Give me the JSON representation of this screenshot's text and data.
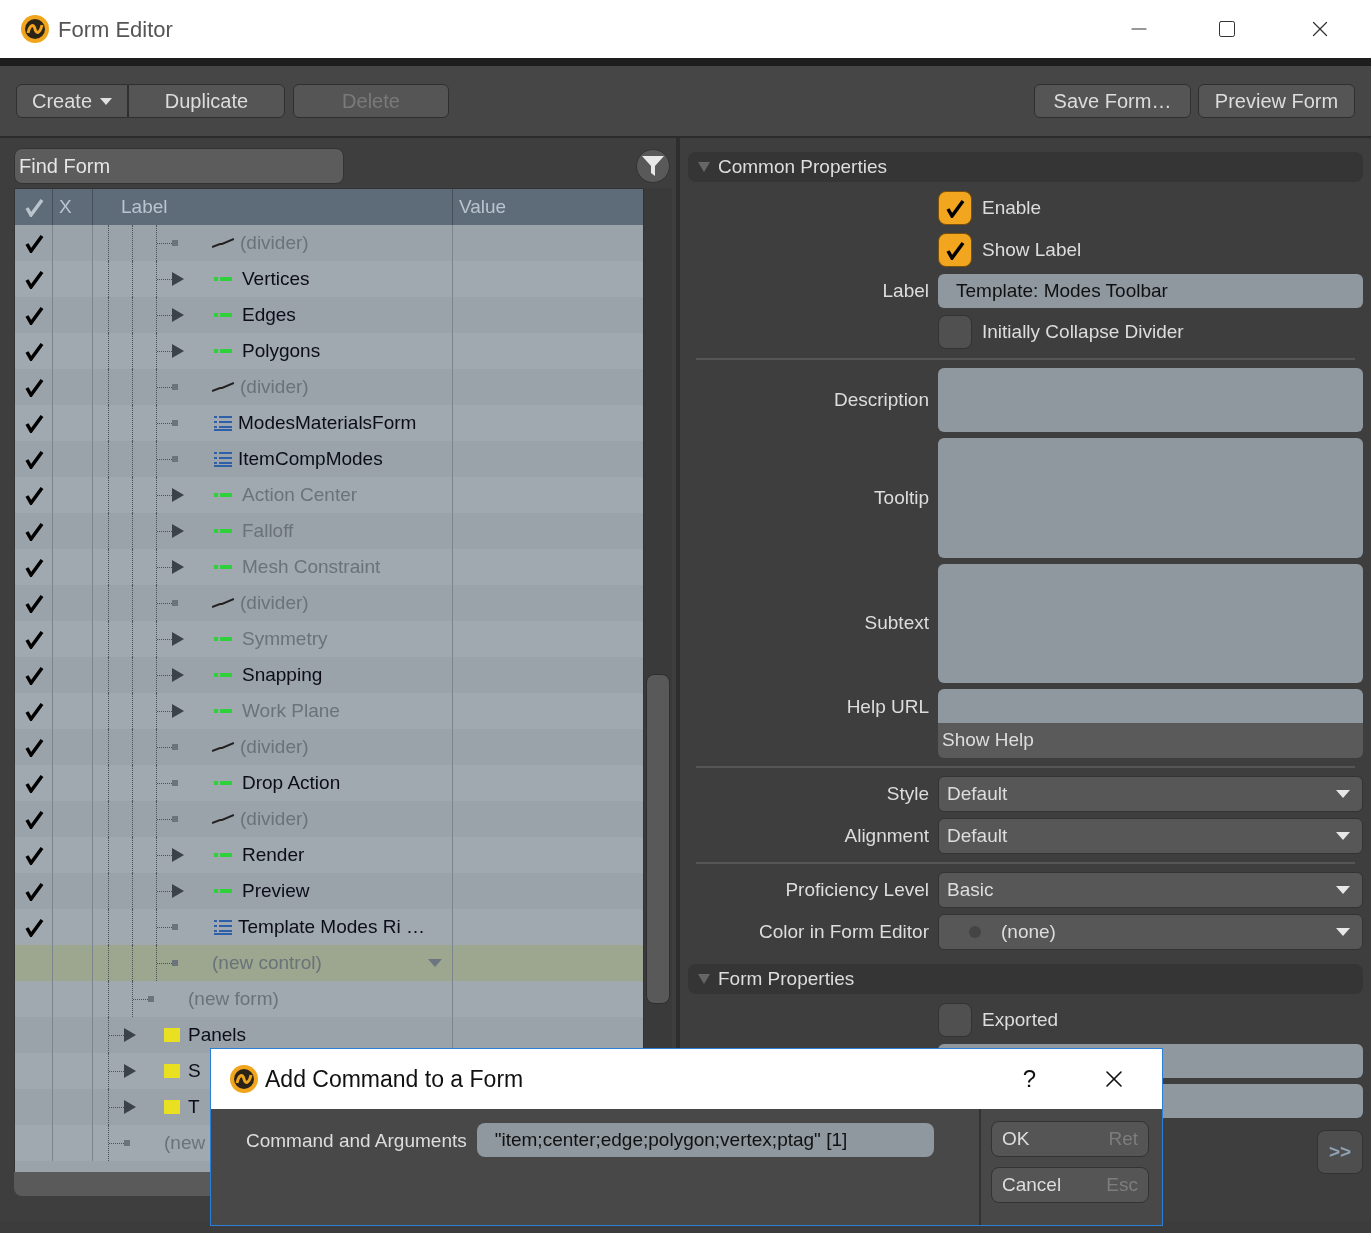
{
  "window": {
    "title": "Form Editor"
  },
  "toolbar": {
    "left": [
      {
        "label": "Create",
        "kind": "menu",
        "disabled": false
      },
      {
        "label": "Duplicate",
        "disabled": false
      },
      {
        "label": "Delete",
        "disabled": true
      }
    ],
    "right": [
      {
        "label": "Save Form…",
        "disabled": false
      },
      {
        "label": "Preview Form",
        "disabled": false
      }
    ]
  },
  "search": {
    "placeholder": "Find Form"
  },
  "tree": {
    "columns": [
      "X",
      "Label",
      "Value"
    ],
    "rows": [
      {
        "children": [
          {
            "children": [
              {
                "label": "(divider)",
                "kind": "divider",
                "expandable": false,
                "enabled": true,
                "dimmed": true,
                "selected": false
              },
              {
                "label": "Vertices",
                "kind": "command",
                "expandable": true,
                "enabled": true,
                "dimmed": false,
                "selected": false
              },
              {
                "label": "Edges",
                "kind": "command",
                "expandable": true,
                "enabled": true,
                "dimmed": false,
                "selected": false
              },
              {
                "label": "Polygons",
                "kind": "command",
                "expandable": true,
                "enabled": true,
                "dimmed": false,
                "selected": false
              },
              {
                "label": "(divider)",
                "kind": "divider",
                "expandable": false,
                "enabled": true,
                "dimmed": true,
                "selected": false
              },
              {
                "label": "ModesMaterialsForm",
                "kind": "form",
                "expandable": false,
                "enabled": true,
                "dimmed": false,
                "selected": false
              },
              {
                "label": "ItemCompModes",
                "kind": "form",
                "expandable": false,
                "enabled": true,
                "dimmed": false,
                "selected": false
              },
              {
                "label": "Action Center",
                "kind": "command",
                "expandable": true,
                "enabled": true,
                "dimmed": true,
                "selected": false
              },
              {
                "label": "Falloff",
                "kind": "command",
                "expandable": true,
                "enabled": true,
                "dimmed": true,
                "selected": false
              },
              {
                "label": "Mesh Constraint",
                "kind": "command",
                "expandable": true,
                "enabled": true,
                "dimmed": true,
                "selected": false
              },
              {
                "label": "(divider)",
                "kind": "divider",
                "expandable": false,
                "enabled": true,
                "dimmed": true,
                "selected": false
              },
              {
                "label": "Symmetry",
                "kind": "command",
                "expandable": true,
                "enabled": true,
                "dimmed": true,
                "selected": false
              },
              {
                "label": "Snapping",
                "kind": "command",
                "expandable": true,
                "enabled": true,
                "dimmed": false,
                "selected": false
              },
              {
                "label": "Work Plane",
                "kind": "command",
                "expandable": true,
                "enabled": true,
                "dimmed": true,
                "selected": false
              },
              {
                "label": "(divider)",
                "kind": "divider",
                "expandable": false,
                "enabled": true,
                "dimmed": true,
                "selected": false
              },
              {
                "label": "Drop Action",
                "kind": "command",
                "expandable": false,
                "enabled": true,
                "dimmed": false,
                "selected": false
              },
              {
                "label": "(divider)",
                "kind": "divider",
                "expandable": false,
                "enabled": true,
                "dimmed": true,
                "selected": false
              },
              {
                "label": "Render",
                "kind": "command",
                "expandable": true,
                "enabled": true,
                "dimmed": false,
                "selected": false
              },
              {
                "label": "Preview",
                "kind": "command",
                "expandable": true,
                "enabled": true,
                "dimmed": false,
                "selected": false
              },
              {
                "label": "Template Modes Ri …",
                "kind": "form",
                "expandable": false,
                "enabled": true,
                "dimmed": false,
                "selected": false
              },
              {
                "label": "(new control)",
                "expandable": false,
                "enabled": false,
                "dimmed": true,
                "selected": true
              }
            ]
          },
          {
            "label": "(new form)",
            "expandable": false,
            "enabled": false,
            "dimmed": true,
            "selected": false
          }
        ]
      },
      {
        "label": "Panels",
        "kind": "folder",
        "expandable": true,
        "enabled": false,
        "dimmed": false,
        "selected": false
      },
      {
        "label": "S",
        "kind": "folder",
        "expandable": true,
        "enabled": false,
        "dimmed": false,
        "selected": false
      },
      {
        "label": "T",
        "kind": "folder",
        "expandable": true,
        "enabled": false,
        "dimmed": false,
        "selected": false
      },
      {
        "label": "(new",
        "expandable": false,
        "enabled": false,
        "dimmed": true,
        "selected": false
      }
    ]
  },
  "properties": [
    {
      "title": "Common Properties",
      "expanded": true,
      "groups": [
        [
          {
            "kind": "checkbox",
            "label": "Enable",
            "checked": true
          },
          {
            "kind": "checkbox",
            "label": "Show Label",
            "checked": true
          },
          {
            "kind": "text",
            "label": "Label",
            "value": "Template: Modes Toolbar"
          },
          {
            "kind": "checkbox",
            "label": "Initially Collapse Divider",
            "checked": false
          }
        ],
        [
          {
            "kind": "memo",
            "label": "Description"
          },
          {
            "kind": "memo",
            "label": "Tooltip"
          },
          {
            "kind": "memo",
            "label": "Subtext"
          },
          {
            "kind": "url",
            "label": "Help URL",
            "button": "Show Help"
          }
        ],
        [
          {
            "kind": "dropdown",
            "label": "Style",
            "value": "Default"
          },
          {
            "kind": "dropdown",
            "label": "Alignment",
            "value": "Default"
          }
        ],
        [
          {
            "kind": "dropdown",
            "label": "Proficiency Level",
            "value": "Basic"
          },
          {
            "kind": "color",
            "label": "Color in Form Editor",
            "value": "(none)"
          }
        ]
      ]
    },
    {
      "title": "Form Properties",
      "expanded": true,
      "groups": [
        [
          {
            "kind": "checkbox",
            "label": "Exported",
            "checked": false
          },
          {
            "kind": "text"
          },
          {
            "kind": "text"
          },
          {
            "kind": "more",
            "button": ">>"
          }
        ]
      ]
    }
  ],
  "dialog": {
    "title": "Add Command to a Form",
    "help": "?",
    "field": {
      "label": "Command and Arguments",
      "value": "\"item;center;edge;polygon;vertex;ptag\" [1]"
    },
    "buttons": [
      {
        "label": "OK",
        "shortcut": "Ret"
      },
      {
        "label": "Cancel",
        "shortcut": "Esc"
      }
    ]
  }
}
